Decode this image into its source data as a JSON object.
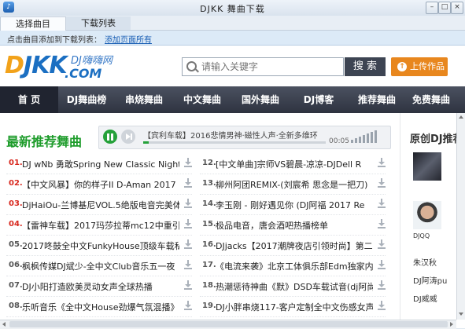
{
  "window": {
    "title": "DJKK 舞曲下载"
  },
  "tabs": [
    {
      "label": "选择曲目"
    },
    {
      "label": "下载列表"
    }
  ],
  "infobar": {
    "text": "点击曲目添加到下载列表：",
    "link": "添加页面所有"
  },
  "logo": {
    "brand_cn": "DJ嗨嗨网",
    "domain": ".COM",
    "mark": "DJKK"
  },
  "search": {
    "placeholder": "请输入关键字",
    "button": "搜 索"
  },
  "upload": {
    "label": "上传作品"
  },
  "nav": [
    {
      "label": "首 页"
    },
    {
      "label": "DJ舞曲榜"
    },
    {
      "label": "串烧舞曲"
    },
    {
      "label": "中文舞曲"
    },
    {
      "label": "国外舞曲"
    },
    {
      "label": "DJ博客"
    },
    {
      "label": "推荐舞曲"
    },
    {
      "label": "免费舞曲"
    }
  ],
  "section": {
    "title": "最新推荐舞曲",
    "right_title": "原创DJ推荐"
  },
  "player": {
    "track": "【宾利车载】2016悲情男神·磁性人声·全新多维环",
    "time": "00:05",
    "progress": 0.03
  },
  "left_list": [
    {
      "num": "01.",
      "name": "DJ wNb 勇敢Spring New Classic Night"
    },
    {
      "num": "02.",
      "name": "【中文风暴】你的样子II D-Aman 2017"
    },
    {
      "num": "03.",
      "name": "DjHaiOu-兰博基尼VOL.5绝版电音完美体"
    },
    {
      "num": "04.",
      "name": "【雷神车载】2017玛莎拉蒂mc12中重引擎"
    },
    {
      "num": "05.",
      "name": "2017咚鼓全中文FunkyHouse顶级车载私货"
    },
    {
      "num": "06.",
      "name": "枫枫传媒DJ斌少-全中文Club音乐五一夜"
    },
    {
      "num": "07.",
      "name": "DJ小阳打造欧美灵动女声全球热播"
    },
    {
      "num": "08.",
      "name": "乐听音乐《全中文House劲爆气氛混播》"
    }
  ],
  "right_list": [
    {
      "num": "12.",
      "name": "[中文单曲]宗师VS碧晨-凉凉-DJDell R"
    },
    {
      "num": "13.",
      "name": "柳州阿团REMIX-(刘宸希 思念是一把刀)"
    },
    {
      "num": "14.",
      "name": "李玉刚 - 刚好遇见你 (DJ阿福 2017 Re"
    },
    {
      "num": "15.",
      "name": "极品电音，唐会酒吧热播榜单"
    },
    {
      "num": "16.",
      "name": "DJjacks【2017潮牌夜店引领时尚】第二"
    },
    {
      "num": "17.",
      "name": "《电流来袭》北京工体俱乐部Edm独家内"
    },
    {
      "num": "18.",
      "name": "热潮惩待神曲《默》DSD车载试音(dj阿尚"
    },
    {
      "num": "19.",
      "name": "DJ小胖串烧117-客户定制全中文伤感女声"
    }
  ],
  "djs": [
    {
      "name": ""
    },
    {
      "name": "DJQQ"
    }
  ],
  "dj_names": [
    {
      "name": "朱汉秋"
    },
    {
      "name": "DJ阿涛pu"
    },
    {
      "name": "DJ威威"
    }
  ],
  "colors": {
    "accent_green": "#1e9c2b",
    "rank_red": "#d8281e",
    "nav_bg": "#3a3f4c",
    "upload_orange": "#e8871e"
  }
}
